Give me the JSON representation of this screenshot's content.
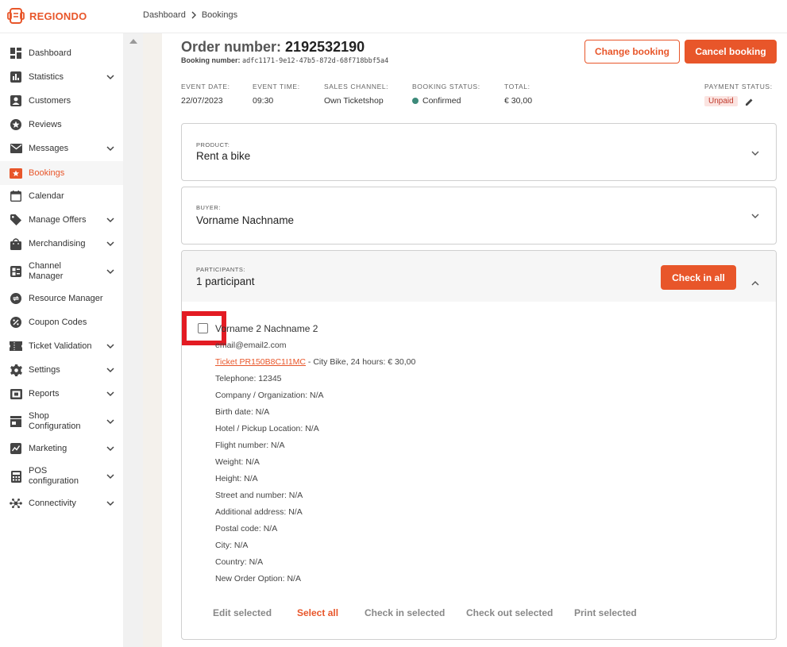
{
  "header": {
    "brand": "REGIONDO",
    "breadcrumb": [
      "Dashboard",
      "Bookings"
    ]
  },
  "sidebar": {
    "items": [
      {
        "label": "Dashboard",
        "icon": "dashboard-icon",
        "expandable": false
      },
      {
        "label": "Statistics",
        "icon": "statistics-icon",
        "expandable": true
      },
      {
        "label": "Customers",
        "icon": "customers-icon",
        "expandable": false
      },
      {
        "label": "Reviews",
        "icon": "star-icon",
        "expandable": false
      },
      {
        "label": "Messages",
        "icon": "mail-icon",
        "expandable": true
      },
      {
        "label": "Bookings",
        "icon": "bookings-icon",
        "expandable": false,
        "active": true
      },
      {
        "label": "Calendar",
        "icon": "calendar-icon",
        "expandable": false
      },
      {
        "label": "Manage Offers",
        "icon": "tag-icon",
        "expandable": true
      },
      {
        "label": "Merchandising",
        "icon": "bag-icon",
        "expandable": true
      },
      {
        "label": "Channel\nManager",
        "icon": "channel-icon",
        "expandable": true
      },
      {
        "label": "Resource Manager",
        "icon": "resource-icon",
        "expandable": false
      },
      {
        "label": "Coupon Codes",
        "icon": "coupon-icon",
        "expandable": false
      },
      {
        "label": "Ticket Validation",
        "icon": "ticket-icon",
        "expandable": true
      },
      {
        "label": "Settings",
        "icon": "gear-icon",
        "expandable": true
      },
      {
        "label": "Reports",
        "icon": "reports-icon",
        "expandable": true
      },
      {
        "label": "Shop\nConfiguration",
        "icon": "shop-icon",
        "expandable": true
      },
      {
        "label": "Marketing",
        "icon": "marketing-icon",
        "expandable": true
      },
      {
        "label": "POS\nconfiguration",
        "icon": "pos-icon",
        "expandable": true
      },
      {
        "label": "Connectivity",
        "icon": "connectivity-icon",
        "expandable": true
      }
    ]
  },
  "order": {
    "title_label": "Order number:",
    "number": "2192532190",
    "booking_number_label": "Booking number:",
    "booking_number": "adfc1171-9e12-47b5-872d-68f718bbf5a4",
    "change_button": "Change booking",
    "cancel_button": "Cancel booking"
  },
  "meta": {
    "event_date_label": "EVENT DATE:",
    "event_date": "22/07/2023",
    "event_time_label": "EVENT TIME:",
    "event_time": "09:30",
    "sales_channel_label": "SALES CHANNEL:",
    "sales_channel": "Own Ticketshop",
    "booking_status_label": "BOOKING STATUS:",
    "booking_status": "Confirmed",
    "total_label": "TOTAL:",
    "total": "€ 30,00",
    "payment_status_label": "PAYMENT STATUS:",
    "payment_status": "Unpaid"
  },
  "product": {
    "label": "PRODUCT:",
    "value": "Rent a bike"
  },
  "buyer": {
    "label": "BUYER:",
    "value": "Vorname Nachname"
  },
  "participants": {
    "label": "PARTICIPANTS:",
    "count": "1 participant",
    "check_in_all": "Check in all",
    "person": {
      "name": "Vorname 2 Nachname 2",
      "email": "email@email2.com",
      "ticket_link": "Ticket PR150B8C1I1MC",
      "ticket_desc": " - City Bike, 24 hours: € 30,00",
      "fields": [
        "Telephone: 12345",
        "Company / Organization: N/A",
        "Birth date: N/A",
        "Hotel / Pickup Location: N/A",
        "Flight number: N/A",
        "Weight: N/A",
        "Height: N/A",
        "Street and number: N/A",
        "Additional address: N/A",
        "Postal code: N/A",
        "City: N/A",
        "Country: N/A",
        "New Order Option: N/A"
      ]
    },
    "actions": {
      "edit": "Edit selected",
      "select_all": "Select all",
      "check_in": "Check in selected",
      "check_out": "Check out selected",
      "print": "Print selected"
    }
  },
  "colors": {
    "accent": "#e8562a",
    "confirmed": "#3d8a7a",
    "highlight": "#e31b23"
  }
}
